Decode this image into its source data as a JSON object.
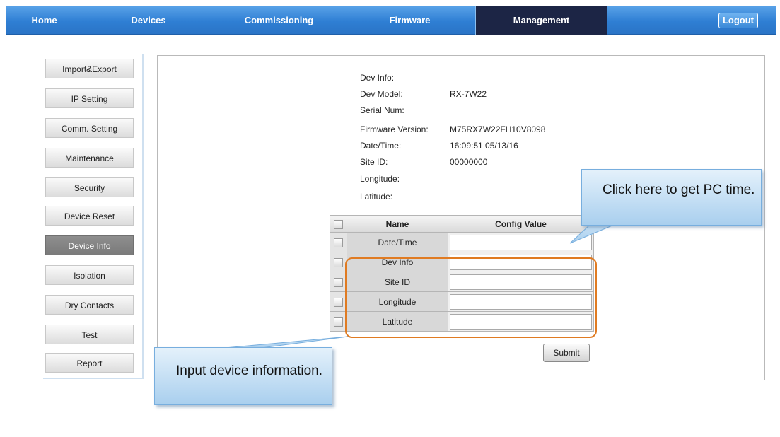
{
  "nav": {
    "items": [
      {
        "label": "Home"
      },
      {
        "label": "Devices"
      },
      {
        "label": "Commissioning"
      },
      {
        "label": "Firmware"
      },
      {
        "label": "Management"
      }
    ],
    "active": "Management",
    "logout_label": "Logout"
  },
  "sidebar": {
    "items": [
      {
        "label": "Import&Export"
      },
      {
        "label": "IP Setting"
      },
      {
        "label": "Comm. Setting"
      },
      {
        "label": "Maintenance"
      },
      {
        "label": "Security"
      },
      {
        "label": "Device Reset"
      },
      {
        "label": "Device Info"
      },
      {
        "label": "Isolation"
      },
      {
        "label": "Dry Contacts"
      },
      {
        "label": "Test"
      },
      {
        "label": "Report"
      }
    ],
    "active": "Device Info"
  },
  "info": [
    {
      "label": "Dev Info:",
      "value": ""
    },
    {
      "label": "Dev Model:",
      "value": "RX-7W22"
    },
    {
      "label": "Serial Num:",
      "value": ""
    },
    {
      "label": "Firmware Version:",
      "value": "M75RX7W22FH10V8098"
    },
    {
      "label": "Date/Time:",
      "value": "16:09:51 05/13/16"
    },
    {
      "label": "Site ID:",
      "value": "00000000"
    },
    {
      "label": "Longitude:",
      "value": ""
    },
    {
      "label": "Latitude:",
      "value": ""
    }
  ],
  "table": {
    "headers": {
      "name": "Name",
      "value": "Config Value"
    },
    "rows": [
      {
        "name": "Date/Time",
        "value": ""
      },
      {
        "name": "Dev Info",
        "value": ""
      },
      {
        "name": "Site ID",
        "value": ""
      },
      {
        "name": "Longitude",
        "value": ""
      },
      {
        "name": "Latitude",
        "value": ""
      }
    ]
  },
  "submit_label": "Submit",
  "callouts": {
    "pc_time": "Click here to get PC time.",
    "device_info": "Input device information."
  },
  "colors": {
    "nav_blue": "#2f7fd4",
    "nav_active": "#1c2545",
    "highlight_orange": "#e07b22",
    "callout_blue": "#a9cfee"
  }
}
